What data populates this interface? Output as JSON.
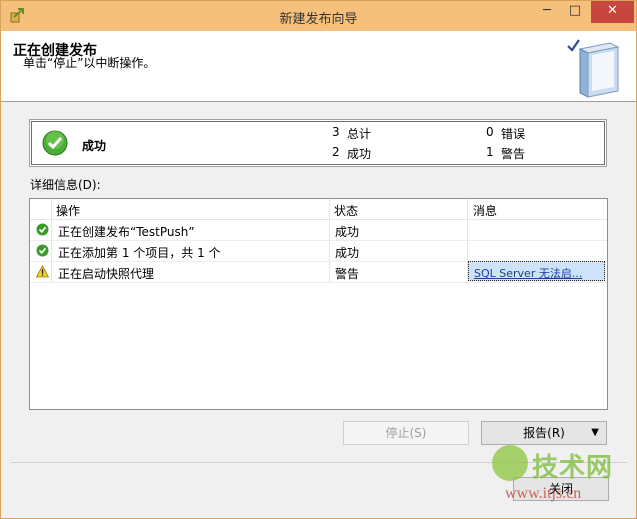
{
  "window": {
    "title": "新建发布向导",
    "controls": {
      "minimize": "─",
      "maximize": "□",
      "close": "✕"
    }
  },
  "header": {
    "title": "正在创建发布",
    "subtitle": "单击“停止”以中断操作。"
  },
  "summary": {
    "status": "成功",
    "total_count": "3",
    "total_label": "总计",
    "success_count": "2",
    "success_label": "成功",
    "error_count": "0",
    "error_label": "错误",
    "warning_count": "1",
    "warning_label": "警告"
  },
  "details": {
    "label": "详细信息(D):",
    "columns": [
      "操作",
      "状态",
      "消息"
    ],
    "rows": [
      {
        "icon": "success-icon",
        "action": "正在创建发布“TestPush”",
        "status": "成功",
        "message": ""
      },
      {
        "icon": "success-icon",
        "action": "正在添加第 1 个项目，共 1 个",
        "status": "成功",
        "message": ""
      },
      {
        "icon": "warning-icon",
        "action": "正在启动快照代理",
        "status": "警告",
        "message": "SQL Server 无法启..."
      }
    ]
  },
  "buttons": {
    "stop": "停止(S)",
    "report": "报告(R)",
    "close": "关闭"
  },
  "watermark": {
    "main": "技术网",
    "url": "www.itjs.cn",
    "logo": "17"
  },
  "colors": {
    "titlebar": "#f5c07b",
    "close": "#c7463e",
    "success": "#3a9a2a",
    "warning": "#e8c21a",
    "link": "#1a3d9a"
  }
}
